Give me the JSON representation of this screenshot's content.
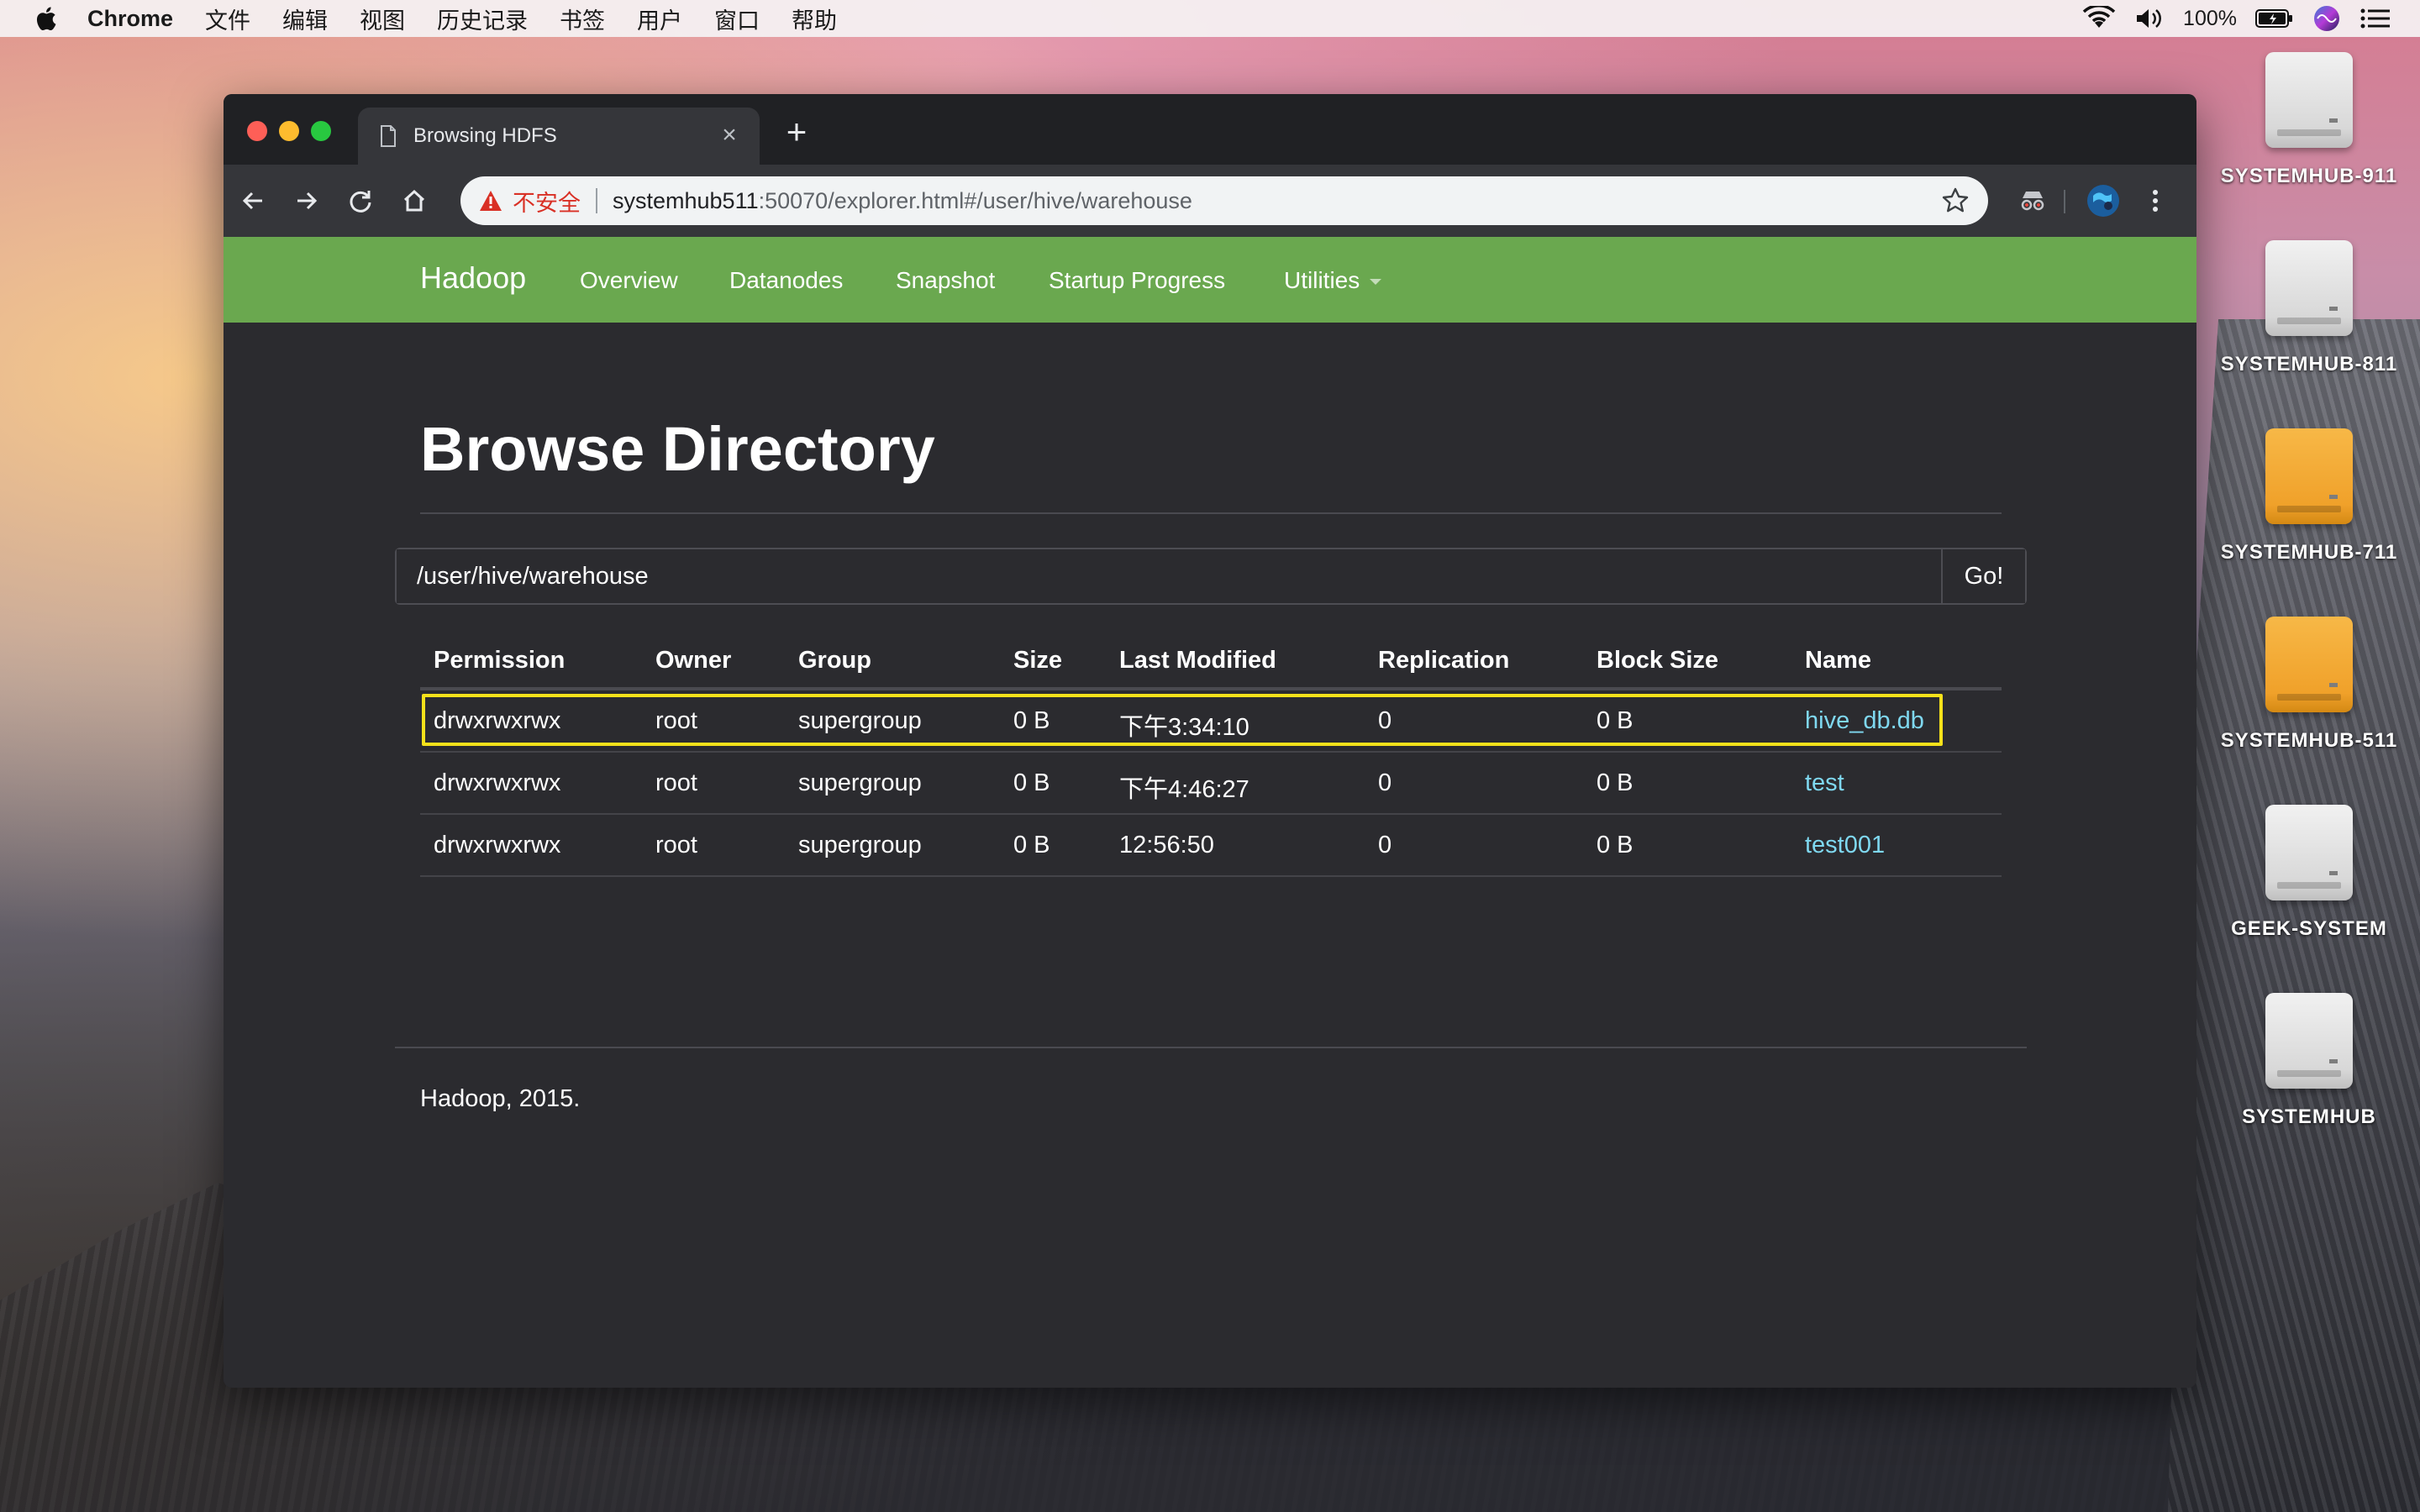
{
  "menubar": {
    "items": [
      "Chrome",
      "文件",
      "编辑",
      "视图",
      "历史记录",
      "书签",
      "用户",
      "窗口",
      "帮助"
    ],
    "battery": "100%"
  },
  "desktop": {
    "icons": [
      {
        "label": "SYSTEMHUB-911",
        "color": "gray"
      },
      {
        "label": "SYSTEMHUB-811",
        "color": "gray"
      },
      {
        "label": "SYSTEMHUB-711",
        "color": "orange"
      },
      {
        "label": "SYSTEMHUB-511",
        "color": "orange"
      },
      {
        "label": "GEEK-SYSTEM",
        "color": "gray"
      },
      {
        "label": "SYSTEMHUB",
        "color": "gray"
      }
    ]
  },
  "browser": {
    "tab_title": "Browsing HDFS",
    "insecure_label": "不安全",
    "url_host": "systemhub511",
    "url_path": ":50070/explorer.html#/user/hive/warehouse"
  },
  "navbar": {
    "brand": "Hadoop",
    "links": [
      "Overview",
      "Datanodes",
      "Snapshot",
      "Startup Progress",
      "Utilities"
    ]
  },
  "page": {
    "title": "Browse Directory",
    "path_value": "/user/hive/warehouse",
    "go_label": "Go!",
    "footer": "Hadoop, 2015."
  },
  "table": {
    "headers": [
      "Permission",
      "Owner",
      "Group",
      "Size",
      "Last Modified",
      "Replication",
      "Block Size",
      "Name"
    ],
    "rows": [
      [
        "drwxrwxrwx",
        "root",
        "supergroup",
        "0 B",
        "下午3:34:10",
        "0",
        "0 B",
        "hive_db.db"
      ],
      [
        "drwxrwxrwx",
        "root",
        "supergroup",
        "0 B",
        "下午4:46:27",
        "0",
        "0 B",
        "test"
      ],
      [
        "drwxrwxrwx",
        "root",
        "supergroup",
        "0 B",
        "12:56:50",
        "0",
        "0 B",
        "test001"
      ]
    ]
  },
  "colors": {
    "navbar_green": "#6aa84f",
    "link_cyan": "#7fd8f0",
    "highlight_yellow": "#f5e11a",
    "insecure_red": "#d93025"
  }
}
